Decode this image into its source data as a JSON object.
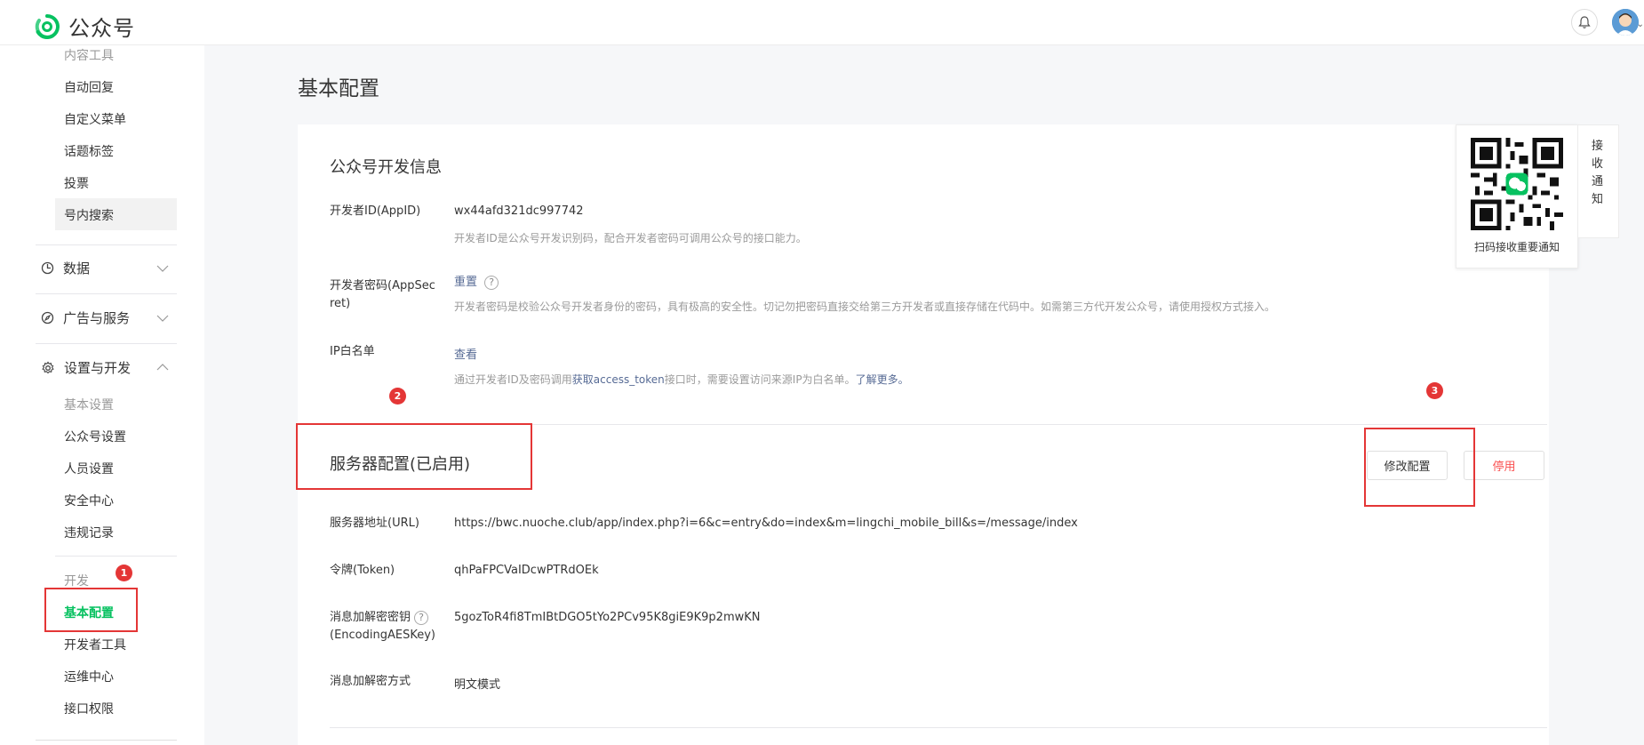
{
  "app": {
    "logo_text": "公众号"
  },
  "sidebar": {
    "content_tools": "内容工具",
    "auto_reply": "自动回复",
    "custom_menu": "自定义菜单",
    "topic_tags": "话题标签",
    "vote": "投票",
    "in_account_search": "号内搜索",
    "data": "数据",
    "ads_services": "广告与服务",
    "settings_dev": "设置与开发",
    "basic_settings": "基本设置",
    "account_settings": "公众号设置",
    "staff_settings": "人员设置",
    "security_center": "安全中心",
    "violation_records": "违规记录",
    "dev": "开发",
    "basic_config": "基本配置",
    "dev_tools": "开发者工具",
    "ops_center": "运维中心",
    "api_permissions": "接口权限"
  },
  "main": {
    "page_title": "基本配置",
    "dev_info": {
      "title": "公众号开发信息",
      "appid_label": "开发者ID(AppID)",
      "appid_value": "wx44afd321dc997742",
      "appid_desc": "开发者ID是公众号开发识别码，配合开发者密码可调用公众号的接口能力。",
      "secret_label_line1": "开发者密码(AppSec",
      "secret_label_line2": "ret)",
      "secret_reset": "重置",
      "secret_desc": "开发者密码是校验公众号开发者身份的密码，具有极高的安全性。切记勿把密码直接交给第三方开发者或直接存储在代码中。如需第三方代开发公众号，请使用授权方式接入。",
      "ip_label": "IP白名单",
      "ip_view": "查看",
      "ip_desc_prefix": "通过开发者ID及密码调用",
      "ip_desc_link": "获取access_token",
      "ip_desc_mid": "接口时，需要设置访问来源IP为白名单。",
      "ip_desc_more": "了解更多。"
    },
    "server": {
      "title": "服务器配置(已启用)",
      "modify_btn": "修改配置",
      "disable_btn": "停用",
      "url_label": "服务器地址(URL)",
      "url_value": "https://bwc.nuoche.club/app/index.php?i=6&c=entry&do=index&m=lingchi_mobile_bill&s=/message/index",
      "token_label": "令牌(Token)",
      "token_value": "qhPaFPCVaIDcwPTRdOEk",
      "aes_label_line1": "消息加解密密钥",
      "aes_label_line2": "(EncodingAESKey)",
      "aes_value": "5gozToR4fi8TmIBtDGO5tYo2PCv95K8giE9K9p2mwKN",
      "mode_label": "消息加解密方式",
      "mode_value": "明文模式"
    }
  },
  "qr": {
    "caption": "扫码接收重要通知",
    "tab_text": "接收通知"
  },
  "annotations": {
    "badge1": "1",
    "badge2": "2",
    "badge3": "3"
  },
  "colors": {
    "brand": "#07c160",
    "link": "#576b95",
    "danger": "#fa5151",
    "annotation": "#e43636"
  }
}
